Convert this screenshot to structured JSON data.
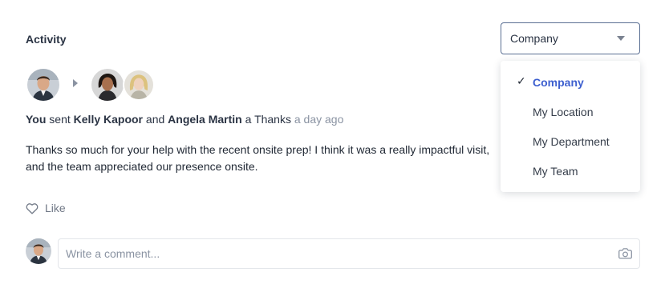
{
  "activity": {
    "title": "Activity"
  },
  "filter": {
    "selected": "Company",
    "options": [
      "Company",
      "My Location",
      "My Department",
      "My Team"
    ],
    "check_glyph": "✓"
  },
  "post": {
    "sender": "You",
    "verb": "sent",
    "recipient_1": "Kelly Kapoor",
    "conjunction": "and",
    "recipient_2": "Angela Martin",
    "article": "a",
    "item": "Thanks",
    "time": "a day ago",
    "message": "Thanks so much for your help with the recent onsite prep! I think it was a really impactful visit, and the team appreciated our presence onsite."
  },
  "actions": {
    "like_label": "Like"
  },
  "comment": {
    "placeholder": "Write a comment..."
  },
  "icons": {
    "like": "heart-icon",
    "camera": "camera-icon",
    "caret": "caret-down-icon",
    "arrow": "arrow-right-icon"
  },
  "colors": {
    "accent": "#3d5fcf",
    "border": "#5a6f93",
    "muted": "#8a93a2"
  }
}
